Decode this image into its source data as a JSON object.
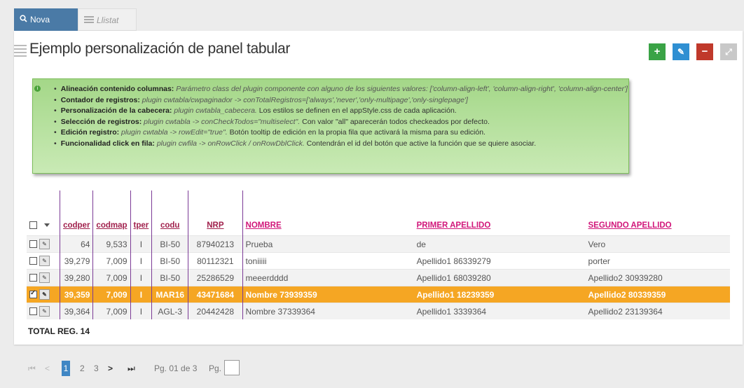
{
  "tabs": {
    "search_label": "Nova busca",
    "list_label": "Llistat"
  },
  "header": {
    "title": "Ejemplo personalización de panel tabular",
    "add_icon": "+",
    "edit_icon": "✎",
    "delete_icon": "−",
    "expand_icon": "⤢"
  },
  "info": {
    "items": [
      {
        "label": "Alineación contenido columnas:",
        "plugin": "Parámetro class del plugin componente con alguno de los siguientes valores: ['column-align-left', 'column-align-right', 'column-align-center']",
        "text": ""
      },
      {
        "label": "Contador de registros:",
        "plugin": "plugin cwtabla/cwpaginador -> conTotalRegistros=['always','never','only-multipage','only-singlepage']",
        "text": ""
      },
      {
        "label": "Personalización de la cabecera:",
        "plugin": "plugin cwtabla_cabecera.",
        "text": " Los estilos se definen en el appStyle.css de cada aplicación."
      },
      {
        "label": "Selección de registros:",
        "plugin": "plugin cwtabla -> conCheckTodos=\"multiselect\".",
        "text": " Con valor \"all\" aparecerán todos checkeados por defecto."
      },
      {
        "label": "Edición registro:",
        "plugin": "plugin cwtabla -> rowEdit=\"true\".",
        "text": " Botón tooltip de edición en la propia fila que activará la misma para su edición."
      },
      {
        "label": "Funcionalidad click en fila:",
        "plugin": "plugin cwfila -> onRowClick / onRowDblClick.",
        "text": " Contendrán el id del botón que active la función que se quiere asociar."
      }
    ]
  },
  "table": {
    "columns": [
      "codper",
      "codmap",
      "tper",
      "codu",
      "NRP",
      "NOMBRE",
      "PRIMER APELLIDO",
      "SEGUNDO APELLIDO"
    ],
    "rows": [
      {
        "checked": false,
        "codper": "64",
        "codmap": "9,533",
        "tper": "I",
        "codu": "BI-50",
        "nrp": "87940213",
        "nombre": "Prueba",
        "ap1": "de",
        "ap2": "Vero"
      },
      {
        "checked": false,
        "codper": "39,279",
        "codmap": "7,009",
        "tper": "I",
        "codu": "BI-50",
        "nrp": "80112321",
        "nombre": "toniiiii",
        "ap1": "Apellido1 86339279",
        "ap2": "porter"
      },
      {
        "checked": false,
        "codper": "39,280",
        "codmap": "7,009",
        "tper": "I",
        "codu": "BI-50",
        "nrp": "25286529",
        "nombre": "meeerdddd",
        "ap1": "Apellido1 68039280",
        "ap2": "Apellido2 30939280"
      },
      {
        "checked": true,
        "codper": "39,359",
        "codmap": "7,009",
        "tper": "I",
        "codu": "MAR16",
        "nrp": "43471684",
        "nombre": "Nombre 73939359",
        "ap1": "Apellido1 18239359",
        "ap2": "Apellido2 80339359"
      },
      {
        "checked": false,
        "codper": "39,364",
        "codmap": "7,009",
        "tper": "I",
        "codu": "AGL-3",
        "nrp": "20442428",
        "nombre": "Nombre 37339364",
        "ap1": "Apellido1 3339364",
        "ap2": "Apellido2 23139364"
      }
    ],
    "selected_row": 3,
    "total_label": "TOTAL REG. 14"
  },
  "pager": {
    "first_icon": "⏮",
    "prev_icon": "<",
    "pages": [
      "1",
      "2",
      "3"
    ],
    "current_page": "1",
    "next_icon": ">",
    "last_icon": "⏭",
    "page_info": "Pg. 01 de 3",
    "goto_label": "Pg."
  },
  "colors": {
    "tab_active": "#4a7aa6",
    "selected_row": "#f5a623",
    "header_pink": "#d1167a",
    "header_red": "#a0204c",
    "info_green": "#a4d788"
  }
}
